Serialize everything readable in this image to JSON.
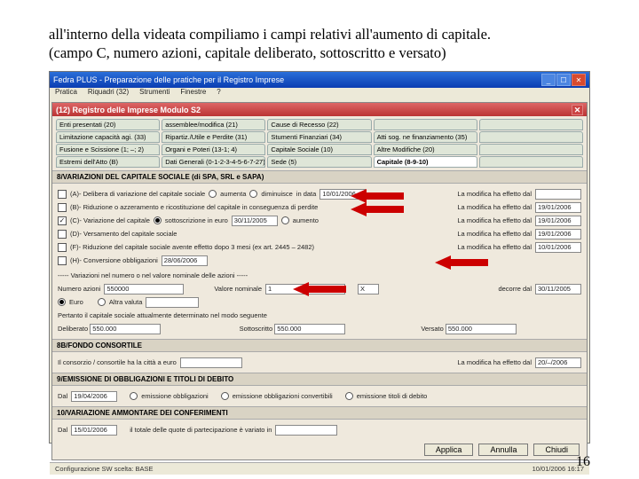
{
  "caption_line1": "all'interno della videata compiliamo i campi relativi all'aumento di capitale.",
  "caption_line2": "(campo C, numero azioni, capitale deliberato, sottoscritto e versato)",
  "page_number": "16",
  "window": {
    "title": "Fedra PLUS - Preparazione delle pratiche per il Registro Imprese",
    "menu": [
      "Pratica",
      "Riquadri (32)",
      "Strumenti",
      "Finestre",
      "?"
    ]
  },
  "inner": {
    "title": "(12) Registro delle Imprese  Modulo S2",
    "tabs": [
      [
        "Enti presentati (20)",
        "assemblee/modifica (21)",
        "Cause di Recesso (22)",
        "",
        ""
      ],
      [
        "Limitazione capacità agi. (33)",
        "Ripartiz./Utile e Perdite (31)",
        "Stumenti Finanziari (34)",
        "Atti sog. ne finanziamento (35)",
        ""
      ],
      [
        "Fusione e Scissione (1; –; 2)",
        "Organi e Poteri (13-1; 4)",
        "Capitale Sociale (10)",
        "Altre Modifiche (20)",
        ""
      ],
      [
        "Estremi dell'Atto (B)",
        "Dati Generali (0-1-2-3-4-5-6-7-27)",
        "Sede (5)",
        "Capitale (8-9-10)",
        ""
      ]
    ]
  },
  "sec_var": "8/VARIAZIONI DEL CAPITALE SOCIALE (di SPA, SRL e SAPA)",
  "items": {
    "A": {
      "label": "(A)- Delibera di variazione del capitale sociale",
      "opt1": "aumenta",
      "opt2": "diminuisce",
      "date_lab": "in data",
      "date": "10/01/2006",
      "right": "La modifica ha effetto dal",
      "rdate": ""
    },
    "B": {
      "label": "(B)- Riduzione o azzeramento e ricostituzione del capitale in conseguenza di perdite",
      "right": "La modifica ha effetto dal",
      "rdate": "19/01/2006"
    },
    "C": {
      "label": "(C)- Variazione del capitale",
      "checked": true,
      "opt1_sel": true,
      "opt1": "sottoscrizione in euro",
      "opt2": "aumento",
      "date": "30/11/2005",
      "right": "La modifica ha effetto dal",
      "rdate": "19/01/2006"
    },
    "D": {
      "label": "(D)- Versamento del capitale sociale",
      "right": "La modifica ha effetto dal",
      "rdate": "19/01/2006"
    },
    "F": {
      "label": "(F)- Riduzione del capitale sociale avente effetto dopo 3 mesi (ex art. 2445 – 2482)",
      "right": "La modifica ha effetto dal",
      "rdate": "10/01/2006"
    },
    "H": {
      "label": "(H)- Conversione obbligazioni",
      "date": "28/06/2006"
    }
  },
  "azioni": {
    "header": "----- Variazioni nel numero o nel valore nominale delle azioni -----",
    "num_label": "Numero azioni",
    "num": "550000",
    "val_label": "Valore nominale",
    "val": "1",
    "unit": "X",
    "decor": "decorre dal",
    "decor_date": "30/11/2005",
    "euro": "Euro",
    "altra": "Altra valuta"
  },
  "cap": {
    "line": "Pertanto il capitale sociale attualmente determinato  nel modo seguente",
    "deliberato_lab": "Deliberato",
    "deliberato": "550.000",
    "sotto_lab": "Sottoscritto",
    "sotto": "550.000",
    "versato_lab": "Versato",
    "versato": "550.000"
  },
  "sec_fondo": "8B/FONDO CONSORTILE",
  "fondo": {
    "right": "La modifica ha effetto dal",
    "rdate": "20/–/2006",
    "label": "Il consorzio / consortile ha la città a euro"
  },
  "sec_obbl": "9/EMISSIONE DI OBBLIGAZIONI E TITOLI DI DEBITO",
  "obbl": {
    "dal": "Dal",
    "date": "19/04/2006",
    "o1": "emissione obbligazioni",
    "o2": "emissione obbligazioni convertibili",
    "o3": "emissione titoli di debito"
  },
  "sec_conf": "10/VARIAZIONE AMMONTARE DEI CONFERIMENTI",
  "conf": {
    "dal": "Dal",
    "date": "15/01/2006",
    "t": "il totale delle quote di partecipazione è variato in"
  },
  "btns": {
    "applica": "Applica",
    "annulla": "Annulla",
    "chiudi": "Chiudi"
  },
  "status": {
    "l": "Configurazione SW scelta: BASE",
    "r": "10/01/2006   16:17"
  }
}
